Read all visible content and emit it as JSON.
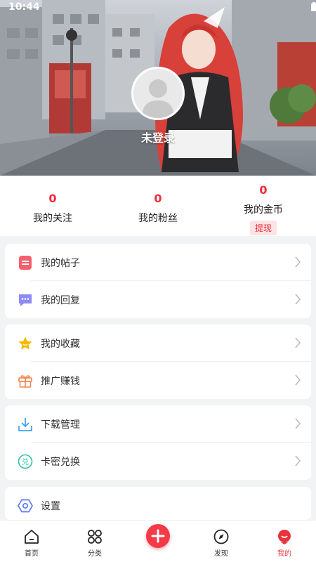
{
  "status_bar": {
    "time": "10:44"
  },
  "profile": {
    "login_text": "未登录"
  },
  "stats": [
    {
      "value": "0",
      "label": "我的关注"
    },
    {
      "value": "0",
      "label": "我的粉丝"
    },
    {
      "value": "0",
      "label": "我的金币",
      "action": "提现"
    }
  ],
  "menu": {
    "group1": [
      {
        "label": "我的帖子",
        "icon": "post-icon"
      },
      {
        "label": "我的回复",
        "icon": "reply-icon"
      }
    ],
    "group2": [
      {
        "label": "我的收藏",
        "icon": "star-icon"
      },
      {
        "label": "推广赚钱",
        "icon": "gift-icon"
      }
    ],
    "group3": [
      {
        "label": "下载管理",
        "icon": "download-icon"
      },
      {
        "label": "卡密兑换",
        "icon": "redeem-icon"
      }
    ],
    "group4": [
      {
        "label": "设置",
        "icon": "settings-icon"
      }
    ]
  },
  "tabbar": {
    "items": [
      {
        "label": "首页",
        "icon": "home-icon"
      },
      {
        "label": "分类",
        "icon": "grid-icon"
      },
      {
        "label": "",
        "icon": "add-icon"
      },
      {
        "label": "发现",
        "icon": "compass-icon"
      },
      {
        "label": "我的",
        "icon": "profile-icon"
      }
    ],
    "active_color": "#e8323c"
  },
  "colors": {
    "accent": "#f02b3c",
    "background": "#f2f3f5"
  }
}
